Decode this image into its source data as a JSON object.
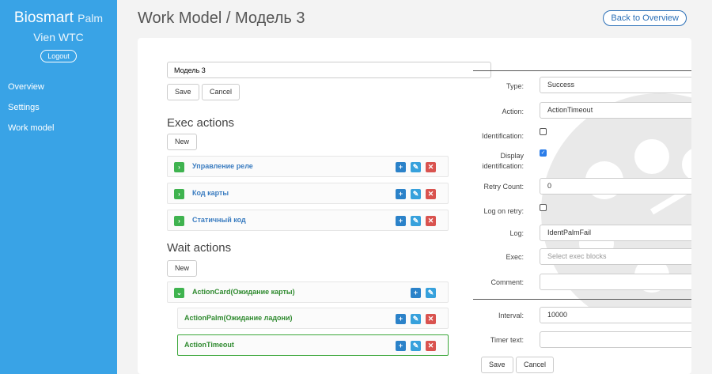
{
  "sidebar": {
    "brand_main": "Biosmart",
    "brand_small": "Palm",
    "subtitle": "Vien WTC",
    "logout_label": "Logout",
    "items": [
      {
        "label": "Overview"
      },
      {
        "label": "Settings"
      },
      {
        "label": "Work model"
      }
    ]
  },
  "header": {
    "title": "Work Model / Модель 3",
    "back_label": "Back to Overview"
  },
  "editor": {
    "name_value": "Модель 3",
    "save_label": "Save",
    "cancel_label": "Cancel"
  },
  "exec": {
    "title": "Exec actions",
    "new_label": "New",
    "items": [
      {
        "label": "Управление реле"
      },
      {
        "label": "Код карты"
      },
      {
        "label": "Статичный код"
      }
    ]
  },
  "wait": {
    "title": "Wait actions",
    "new_label": "New",
    "items": [
      {
        "label": "ActionCard(Ожидание карты)"
      },
      {
        "label": "ActionPalm(Ожидание ладони)"
      },
      {
        "label": "ActionTimeout"
      }
    ]
  },
  "form": {
    "type_label": "Type:",
    "type_value": "Success",
    "action_label": "Action:",
    "action_value": "ActionTimeout",
    "identification_label": "Identification:",
    "identification_checked": false,
    "display_label_1": "Display",
    "display_label_2": "identification:",
    "display_checked": true,
    "retry_label": "Retry Count:",
    "retry_value": "0",
    "log_retry_label": "Log on retry:",
    "log_retry_checked": false,
    "log_label": "Log:",
    "log_value": "IdentPalmFail",
    "exec_label": "Exec:",
    "exec_placeholder": "Select exec blocks",
    "comment_label": "Comment:",
    "comment_value": "",
    "interval_label": "Interval:",
    "interval_value": "10000",
    "timer_label": "Timer text:",
    "timer_value": "",
    "save_label": "Save",
    "cancel_label": "Cancel"
  },
  "colors": {
    "sidebar": "#39a3e6",
    "accent_green": "#3fb34f",
    "add_blue": "#2b82c9",
    "delete_red": "#d9534f"
  }
}
